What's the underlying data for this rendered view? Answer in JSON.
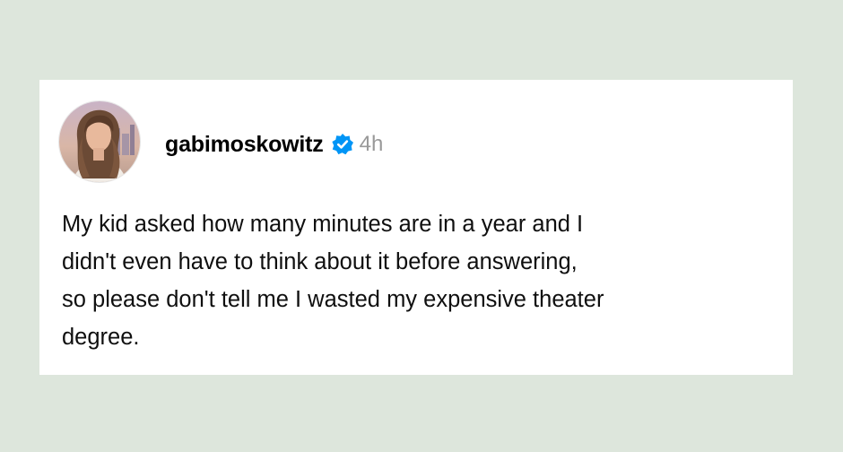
{
  "colors": {
    "background": "#dde6dc",
    "card": "#ffffff",
    "verified_badge": "#0095f6",
    "timestamp": "#999999",
    "text": "#0f0f0f"
  },
  "post": {
    "author": {
      "username": "gabimoskowitz",
      "verified": true,
      "verified_icon": "verified-badge-icon",
      "avatar": "profile-photo"
    },
    "timestamp": "4h",
    "text_lines": [
      "My kid asked how many minutes are in a year and I",
      "didn't even have to think about it before answering,",
      "so please don't tell me I wasted my expensive theater",
      "degree."
    ]
  }
}
